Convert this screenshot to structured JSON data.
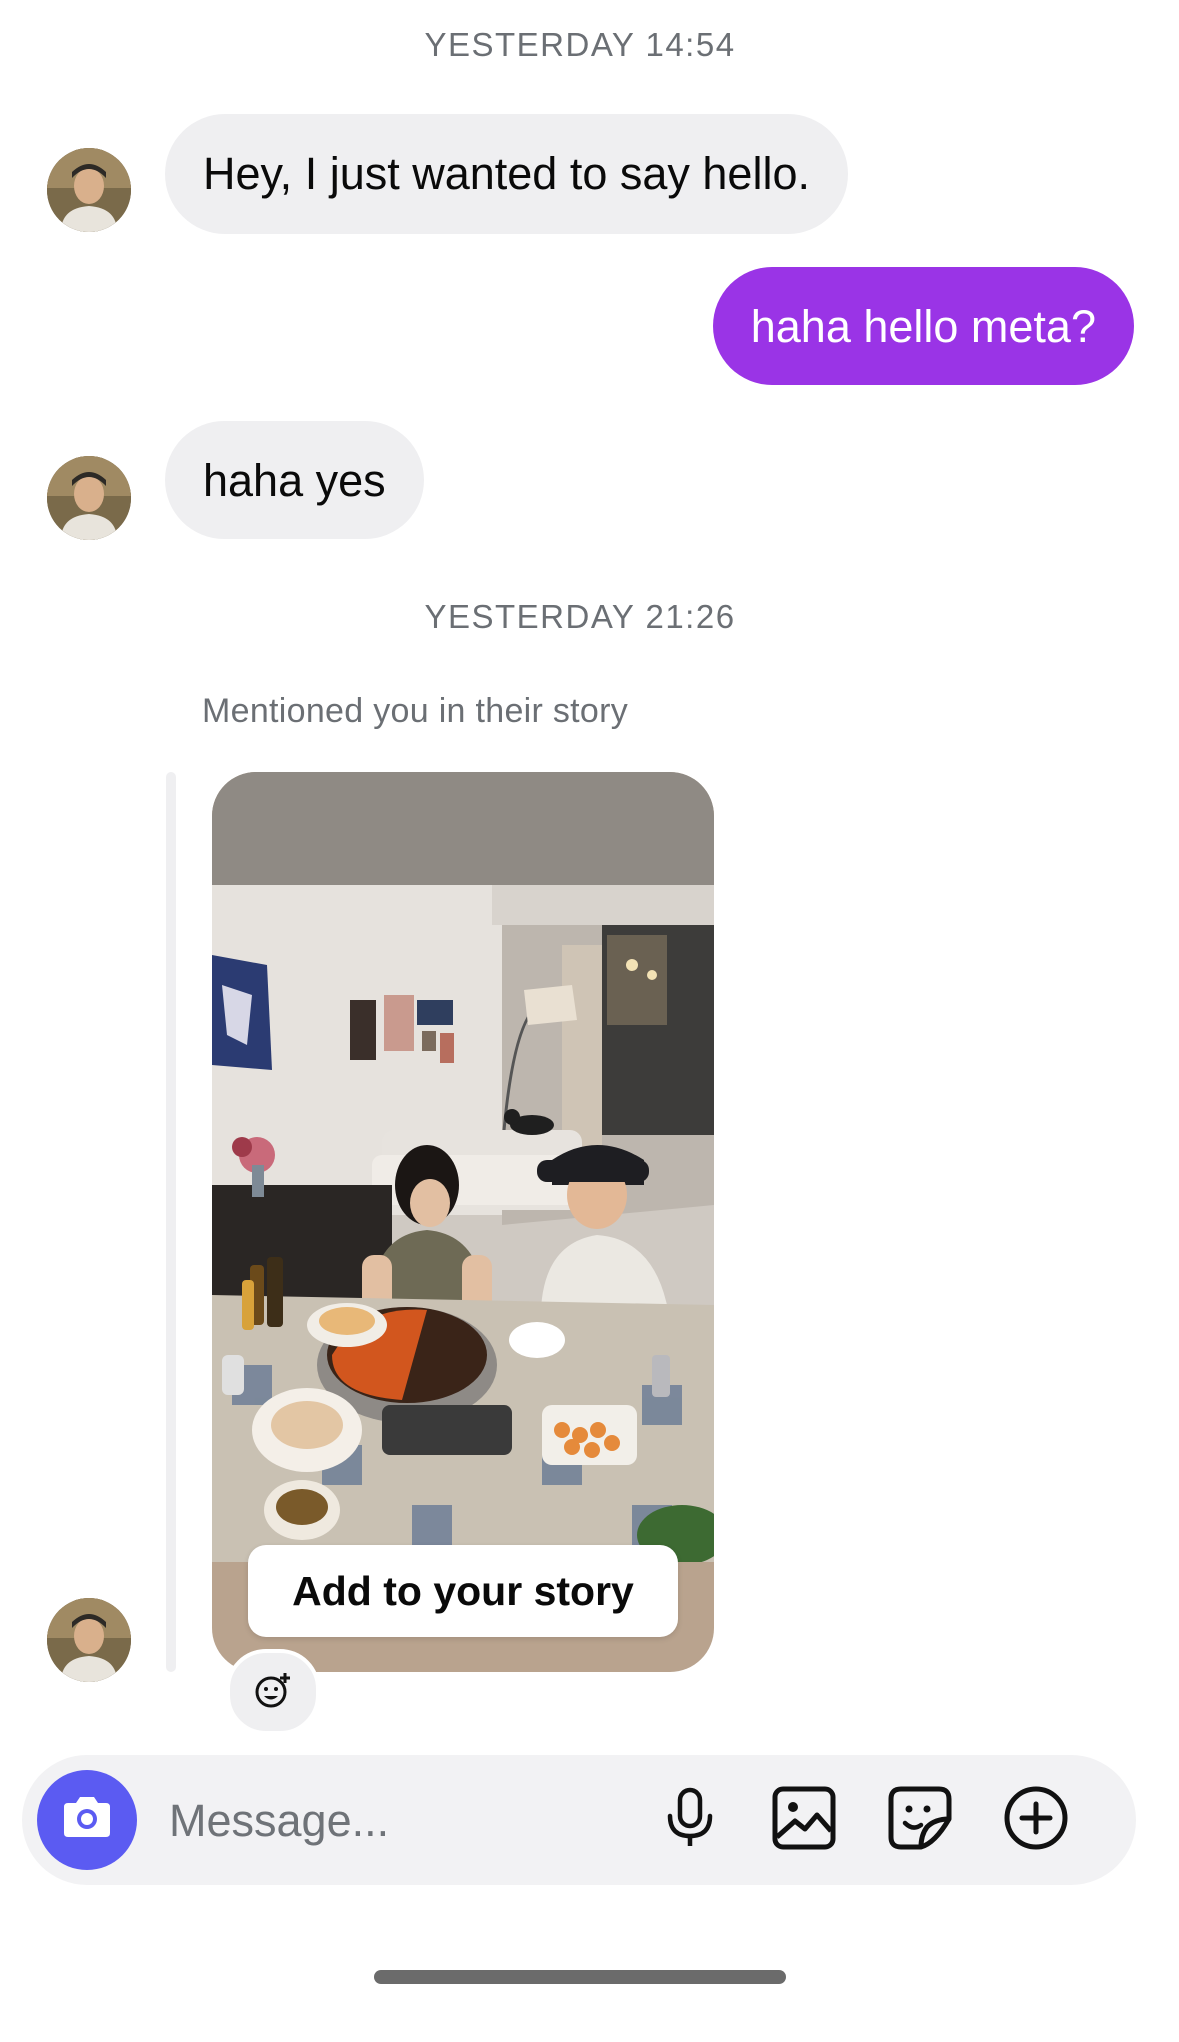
{
  "conversation": {
    "timestamp_1": "YESTERDAY 14:54",
    "timestamp_2": "YESTERDAY 21:26",
    "messages": [
      {
        "direction": "incoming",
        "text": "Hey, I just wanted to say hello."
      },
      {
        "direction": "outgoing",
        "text": "haha hello meta?"
      },
      {
        "direction": "incoming",
        "text": "haha yes"
      }
    ],
    "story_mention": {
      "note": "Mentioned you in their story",
      "add_button_label": "Add to your story",
      "reaction_icon": "emoji-add-icon"
    }
  },
  "composer": {
    "placeholder": "Message...",
    "icons": [
      "camera-icon",
      "microphone-icon",
      "gallery-icon",
      "sticker-icon",
      "plus-circle-icon"
    ]
  },
  "colors": {
    "outgoing_bubble": "#9a34e6",
    "incoming_bubble": "#efeff1",
    "camera_button": "#5b5bf2",
    "timestamp_text": "#6b6f74"
  }
}
